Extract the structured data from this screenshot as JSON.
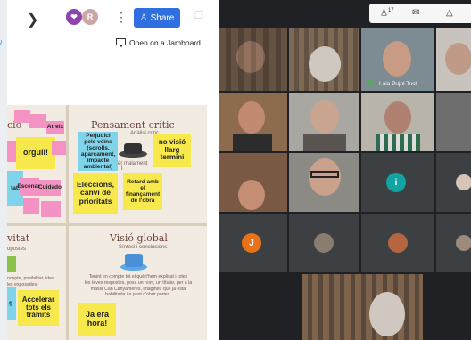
{
  "jamboard": {
    "share_label": "Share",
    "open_label": "Open on a Jamboard",
    "avatar_r": "R",
    "sections": {
      "critic_title": "Pensament crític",
      "critic_sub": "Anàlisi crític",
      "critic_mid": "er malament",
      "critic_i": "i",
      "left_top": "ció",
      "left_bottom": "vitat",
      "left_bottom_sub": "opostes",
      "left_para": "ncepte, posibilitat, idea\nles exposades!",
      "global_title": "Visió global",
      "global_sub": "Síntesi i conclusions",
      "global_para": "Tenint en compte tot el què t'hem explicat i totes\nles teves respostes, posa un nom, un títular, per a la\nmasia Can Canyameres, imagineu que ja esta\nhabilitada i a punt d'obrir portes."
    },
    "stickies": {
      "orgull": "orgull!",
      "atreix": "Atreix",
      "perjudici": "Perjudici pels veïns (sorolls, aparcament, impacte ambiental)",
      "no_visio": "no visió llarg termini",
      "eleccions": "Eleccions, canvi de prioritats",
      "retard": "Retard amb el finançament de l'obra",
      "cuidado": "Cuidado",
      "escenari": "Escenari",
      "acceletar": "Accelerar tots els tràmits",
      "ja_era": "Ja era hora!",
      "tat": "tat,",
      "g": "g."
    }
  },
  "meet": {
    "participant_count": "17",
    "participant_name": "Laia Pujol Tost",
    "initial_i": "i",
    "initial_j": "J"
  }
}
